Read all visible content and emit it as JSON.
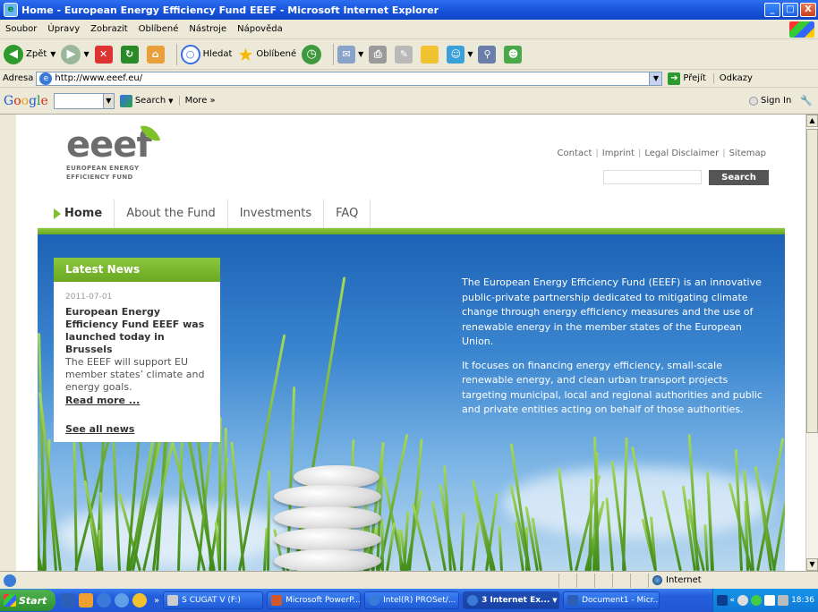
{
  "window": {
    "title": "Home - European Energy Efficiency Fund EEEF - Microsoft Internet Explorer",
    "minimize": "_",
    "maximize": "□",
    "close": "X"
  },
  "menu": [
    "Soubor",
    "Úpravy",
    "Zobrazit",
    "Oblíbené",
    "Nástroje",
    "Nápověda"
  ],
  "toolbar": {
    "back_label": "Zpět",
    "search_label": "Hledat",
    "favorites_label": "Oblíbené"
  },
  "address": {
    "label": "Adresa",
    "url": "http://www.eeef.eu/",
    "go_label": "Přejít",
    "links_label": "Odkazy"
  },
  "google": {
    "logo": [
      "G",
      "o",
      "o",
      "g",
      "l",
      "e"
    ],
    "search_label": "Search",
    "more_label": "More »",
    "signin_label": "Sign In"
  },
  "site": {
    "logo_word": "eeef",
    "logo_sub1": "EUROPEAN ENERGY",
    "logo_sub2": "EFFICIENCY FUND",
    "toplinks": [
      "Contact",
      "Imprint",
      "Legal Disclaimer",
      "Sitemap"
    ],
    "search_button": "Search",
    "nav": [
      "Home",
      "About the Fund",
      "Investments",
      "FAQ"
    ],
    "news": {
      "heading": "Latest News",
      "date": "2011-07-01",
      "title": "European Energy Efficiency Fund EEEF was launched today in Brussels",
      "desc": "The EEEF will support EU member states’ climate and energy goals.",
      "read_more": "Read more ...",
      "see_all": "See all news"
    },
    "hero_p1": "The European Energy Efficiency Fund (EEEF) is an innovative public-private partnership dedicated to mitigating climate change through energy efficiency measures and the use of renewable energy in the member states of the European Union.",
    "hero_p2": "It focuses on financing energy efficiency, small-scale renewable energy, and clean urban transport projects targeting municipal, local and regional authorities and public and private entities acting on behalf of those authorities."
  },
  "status": {
    "zone": "Internet"
  },
  "taskbar": {
    "start": "Start",
    "tasks": [
      "S CUGAT V (F:)",
      "Microsoft PowerP...",
      "Intel(R) PROSet/...",
      "3 Internet Ex...",
      "Document1 - Micr..."
    ],
    "clock": "18:36"
  }
}
